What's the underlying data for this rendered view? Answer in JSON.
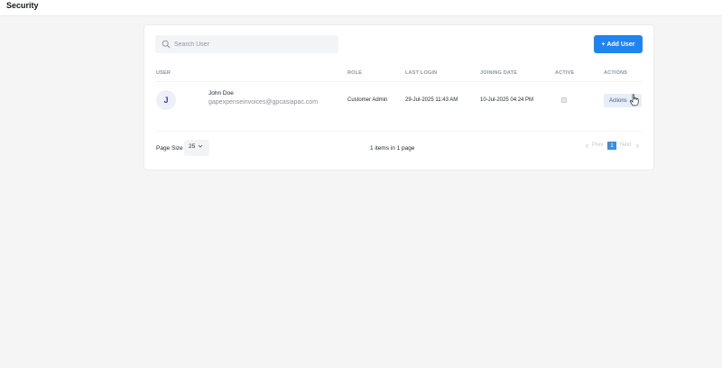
{
  "header": {
    "title": "Security"
  },
  "search": {
    "placeholder": "Search User",
    "value": ""
  },
  "toolbar": {
    "add_user_label": "+ Add User"
  },
  "table": {
    "columns": {
      "user": "USER",
      "role": "ROLE",
      "last_login": "LAST LOGIN",
      "joining_date": "JOINING DATE",
      "active": "ACTIVE",
      "actions": "ACTIONS"
    },
    "rows": [
      {
        "avatar_initial": "J",
        "name": "John Doe",
        "email": "gapexpenseinvoices@gpcasiapac.com",
        "role": "Customer Admin",
        "last_login": "29-Jul-2025 11:43 AM",
        "joining_date": "10-Jul-2025 04:24 PM",
        "active": false,
        "actions_label": "Actions"
      }
    ]
  },
  "footer": {
    "page_size_label": "Page Size",
    "page_size_value": "25",
    "items_info": "1 items in 1 page",
    "pagination": {
      "prev_label": "Prev",
      "current_page": "1",
      "next_label": "Next"
    }
  },
  "colors": {
    "primary": "#1e84f0",
    "page_bg": "#f5f5f6",
    "pager_active": "#3d8ee0"
  },
  "icons": [
    "search-icon",
    "chevron-down-icon",
    "chevron-left-icon",
    "chevron-right-icon",
    "hand-pointer-icon"
  ]
}
